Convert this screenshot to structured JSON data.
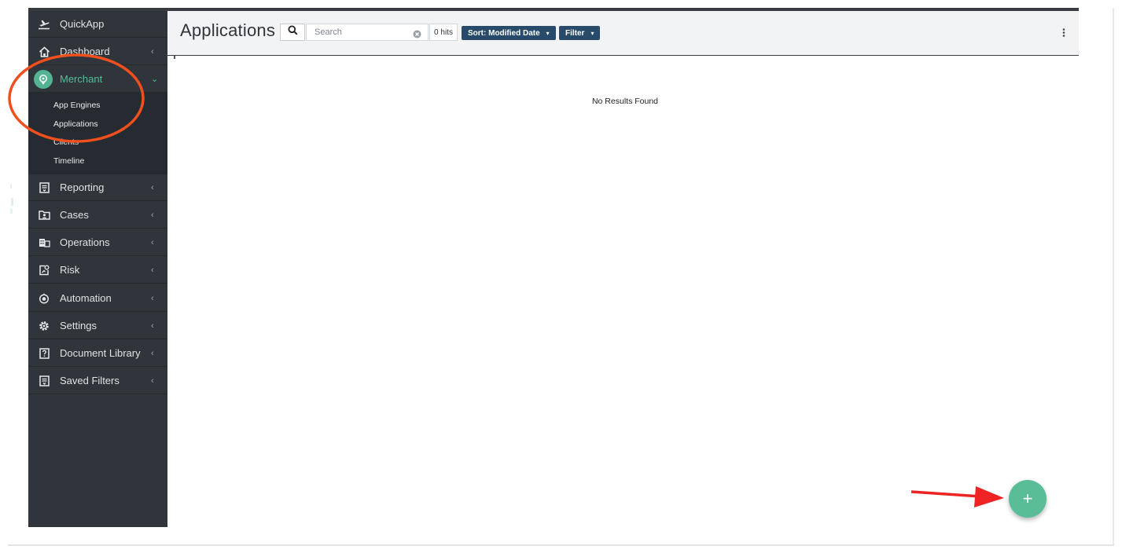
{
  "app": {
    "name": "QuickApp"
  },
  "sidebar": {
    "top": [
      {
        "label": "QuickApp",
        "icon": "plane-takeoff-icon"
      },
      {
        "label": "Dashboard",
        "icon": "home-icon"
      }
    ],
    "merchant": {
      "label": "Merchant",
      "icon": "location-pin-icon",
      "expanded": true,
      "children": [
        "App Engines",
        "Applications",
        "Clients",
        "Timeline"
      ]
    },
    "items": [
      {
        "label": "Reporting",
        "icon": "report-icon"
      },
      {
        "label": "Cases",
        "icon": "folder-user-icon"
      },
      {
        "label": "Operations",
        "icon": "building-icon"
      },
      {
        "label": "Risk",
        "icon": "risk-icon"
      },
      {
        "label": "Automation",
        "icon": "automation-icon"
      },
      {
        "label": "Settings",
        "icon": "gear-icon"
      },
      {
        "label": "Document Library",
        "icon": "help-document-icon"
      },
      {
        "label": "Saved Filters",
        "icon": "saved-filter-icon"
      }
    ]
  },
  "header": {
    "title": "Applications",
    "search_placeholder": "Search",
    "search_value": "",
    "hits": "0 hits",
    "sort_label": "Sort: Modified Date",
    "filter_label": "Filter"
  },
  "main": {
    "empty_message": "No Results Found"
  },
  "fab": {
    "label": "+"
  },
  "colors": {
    "sidebar_bg": "#2f353b",
    "submenu_bg": "#262b31",
    "accent_green": "#54bc9b",
    "button_navy": "#284b6b",
    "annotation_orange": "#f0501e",
    "annotation_red": "#ee2424"
  }
}
